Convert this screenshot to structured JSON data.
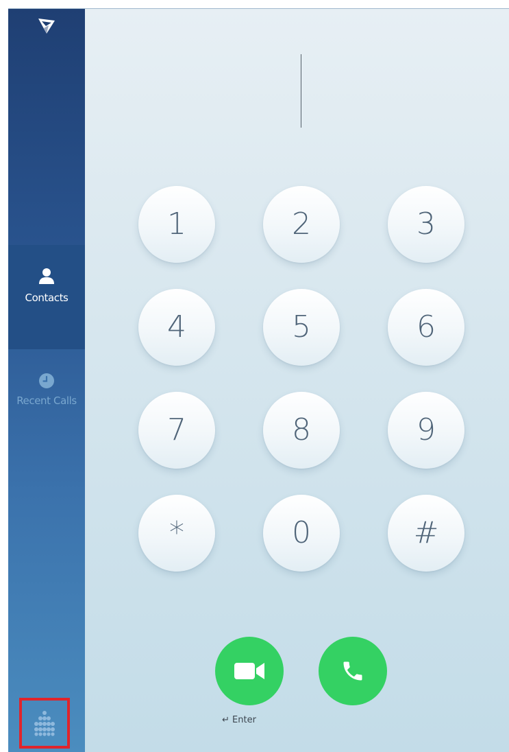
{
  "sidebar": {
    "logo_icon": "grandstream-logo-icon",
    "items": [
      {
        "label": "Contacts",
        "icon": "person-icon",
        "active": true
      },
      {
        "label": "Recent Calls",
        "icon": "clock-icon",
        "active": false
      }
    ],
    "dialpad_toggle_icon": "dialpad-grid-icon",
    "highlight_color": "#e0242b"
  },
  "dialer": {
    "number_value": "",
    "keys": [
      "1",
      "2",
      "3",
      "4",
      "5",
      "6",
      "7",
      "8",
      "9",
      "*",
      "0",
      "#"
    ],
    "video_call_icon": "video-camera-icon",
    "audio_call_icon": "phone-icon",
    "enter_hint": "↵ Enter",
    "call_button_color": "#34d163"
  }
}
